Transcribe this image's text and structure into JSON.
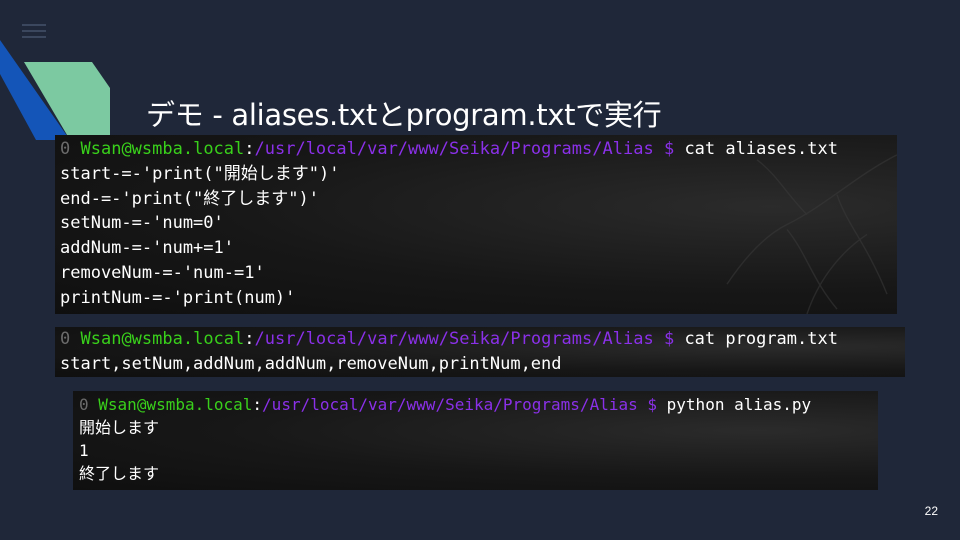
{
  "slide": {
    "title": "デモ - aliases.txtとprogram.txtで実行",
    "page_number": "22"
  },
  "terminals": [
    {
      "prompt": {
        "code": "0",
        "user_host": "Wsan@wsmba.local",
        "path": "/usr/local/var/www/Seika/Programs/Alias",
        "symbol": "$",
        "command": "cat aliases.txt"
      },
      "output": [
        "start-=-'print(\"開始します\")'",
        "end-=-'print(\"終了します\")'",
        "setNum-=-'num=0'",
        "addNum-=-'num+=1'",
        "removeNum-=-'num-=1'",
        "printNum-=-'print(num)'"
      ]
    },
    {
      "prompt": {
        "code": "0",
        "user_host": "Wsan@wsmba.local",
        "path": "/usr/local/var/www/Seika/Programs/Alias",
        "symbol": "$",
        "command": "cat program.txt"
      },
      "output": [
        "start,setNum,addNum,addNum,removeNum,printNum,end"
      ]
    },
    {
      "prompt": {
        "code": "0",
        "user_host": "Wsan@wsmba.local",
        "path": "/usr/local/var/www/Seika/Programs/Alias",
        "symbol": "$",
        "command": "python alias.py"
      },
      "output": [
        "開始します",
        "1",
        "終了します"
      ]
    }
  ],
  "colors": {
    "background": "#1f2739",
    "accent_blue": "#1455b8",
    "accent_green": "#7cc9a1",
    "prompt_user": "#39d01b",
    "prompt_path": "#8a30e8"
  },
  "icons": {
    "menu": "hamburger-menu-icon"
  }
}
